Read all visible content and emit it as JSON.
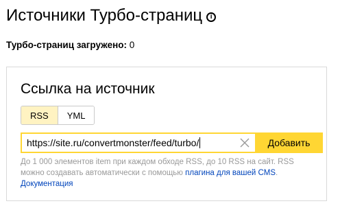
{
  "header": {
    "title": "Источники Турбо-страниц",
    "info_glyph": "i"
  },
  "stats": {
    "loaded_label": "Турбо-страниц загружено:",
    "loaded_value": "0"
  },
  "source_card": {
    "title": "Ссылка на источник",
    "tabs": [
      {
        "label": "RSS",
        "active": true
      },
      {
        "label": "YML",
        "active": false
      }
    ],
    "url_value": "https://site.ru/convertmonster/feed/turbo/",
    "submit_label": "Добавить",
    "hint_text": "До 1 000 элементов item при каждом обходе RSS, до 10 RSS на сайт. RSS можно создавать автоматически с помощью ",
    "hint_link_plugins": "плагина для вашей CMS",
    "hint_separator": ". ",
    "hint_link_docs": "Документация"
  },
  "colors": {
    "accent_yellow": "#ffd633",
    "active_tab_bg": "#fff3c2",
    "link_blue": "#0044bb",
    "hint_gray": "#999999"
  }
}
